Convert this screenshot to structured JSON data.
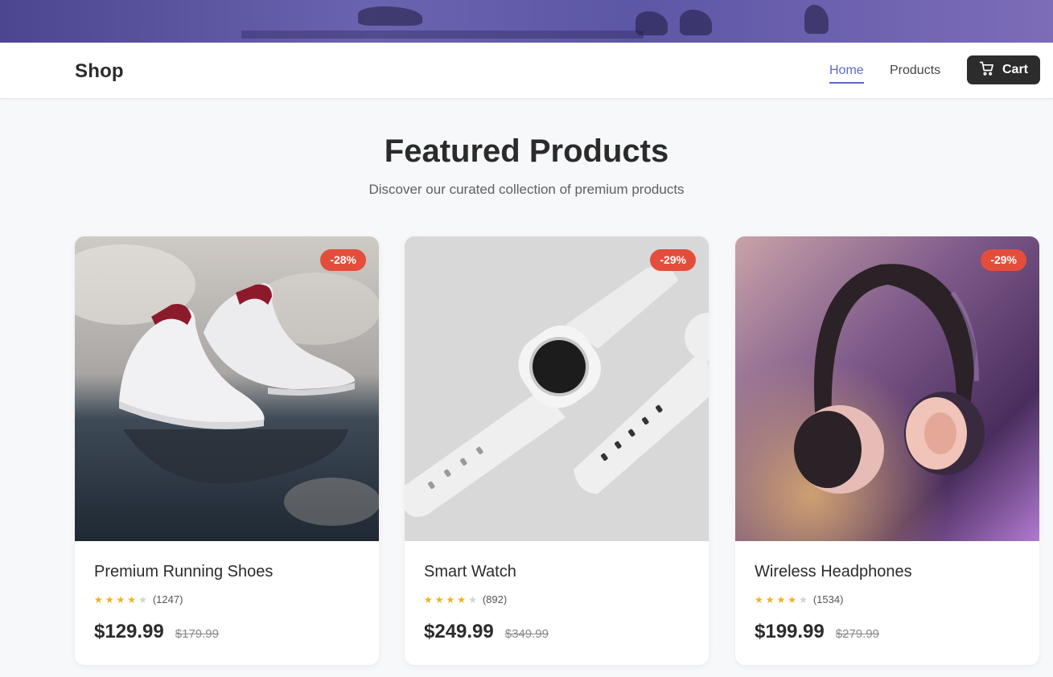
{
  "header": {
    "brand": "Shop",
    "nav": [
      {
        "label": "Home",
        "active": true
      },
      {
        "label": "Products",
        "active": false
      }
    ],
    "cart_label": "Cart",
    "accent_color": "#5b6ad0"
  },
  "hero": {
    "title": "Featured Products",
    "subtitle": "Discover our curated collection of premium products"
  },
  "products": [
    {
      "name": "Premium Running Shoes",
      "badge": "-28%",
      "rating": 4,
      "reviews": "(1247)",
      "price": "$129.99",
      "old_price": "$179.99",
      "image": "white-sneakers-photo"
    },
    {
      "name": "Smart Watch",
      "badge": "-29%",
      "rating": 4,
      "reviews": "(892)",
      "price": "$249.99",
      "old_price": "$349.99",
      "image": "white-smartwatch-photo"
    },
    {
      "name": "Wireless Headphones",
      "badge": "-29%",
      "rating": 4,
      "reviews": "(1534)",
      "price": "$199.99",
      "old_price": "$279.99",
      "image": "headphones-photo"
    }
  ],
  "colors": {
    "badge": "#e44d3b",
    "star": "#f2b01e",
    "cart_button": "#2c2c2c"
  }
}
